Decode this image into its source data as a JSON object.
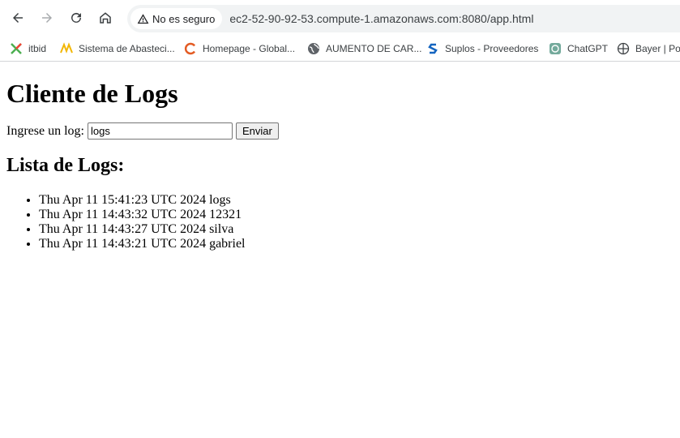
{
  "browser": {
    "security_label": "No es seguro",
    "url": "ec2-52-90-92-53.compute-1.amazonaws.com:8080/app.html",
    "bookmarks": [
      {
        "label": "itbid",
        "icon": "itbid-icon"
      },
      {
        "label": "Sistema de Abasteci...",
        "icon": "abastecimiento-icon"
      },
      {
        "label": "Homepage - Global...",
        "icon": "homepage-icon"
      },
      {
        "label": "AUMENTO DE CAR...",
        "icon": "globe-icon"
      },
      {
        "label": "Suplos - Proveedores",
        "icon": "suplos-icon"
      },
      {
        "label": "ChatGPT",
        "icon": "chatgpt-icon"
      },
      {
        "label": "Bayer | Por",
        "icon": "bayer-icon"
      }
    ]
  },
  "page": {
    "title": "Cliente de Logs",
    "input_label": "Ingrese un log:",
    "input_value": "logs",
    "submit_label": "Enviar",
    "list_title": "Lista de Logs:",
    "logs": [
      "Thu Apr 11 15:41:23 UTC 2024 logs",
      "Thu Apr 11 14:43:32 UTC 2024 12321",
      "Thu Apr 11 14:43:27 UTC 2024 silva",
      "Thu Apr 11 14:43:21 UTC 2024 gabriel"
    ]
  }
}
